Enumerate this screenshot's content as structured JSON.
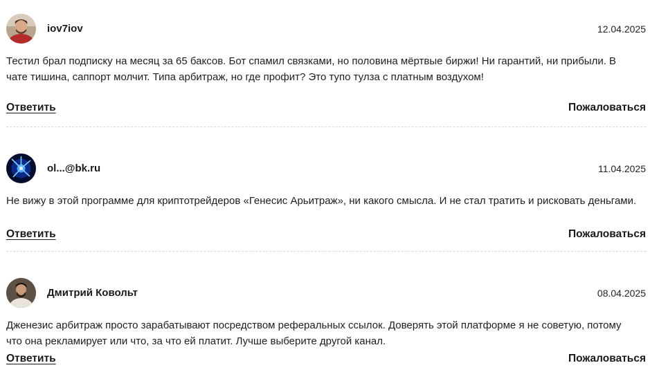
{
  "comments": [
    {
      "author": "iov7iov",
      "date": "12.04.2025",
      "text": "Тестил брал подписку на месяц за 65 баксов. Бот спамил связками, но половина мёртвые биржи! Ни гарантий, ни прибыли. В чате тишина, саппорт молчит. Типа арбитраж, но где профит? Это тупо тулза с платным воздухом!",
      "reply_label": "Ответить",
      "report_label": "Пожаловаться"
    },
    {
      "author": "ol...@bk.ru",
      "date": "11.04.2025",
      "text": "Не вижу в этой программе для криптотрейдеров «Генесис Арьитраж», ни какого смысла. И не стал тратить и рисковать деньгами.",
      "reply_label": "Ответить",
      "report_label": "Пожаловаться"
    },
    {
      "author": "Дмитрий Ковольт",
      "date": "08.04.2025",
      "text": "Дженезис арбитраж просто зарабатывают посредством реферальных ссылок. Доверять этой платформе я не советую, потому что она рекламирует или что, за что ей платит. Лучше выберите другой канал.",
      "reply_label": "Ответить",
      "report_label": "Пожаловаться"
    }
  ]
}
